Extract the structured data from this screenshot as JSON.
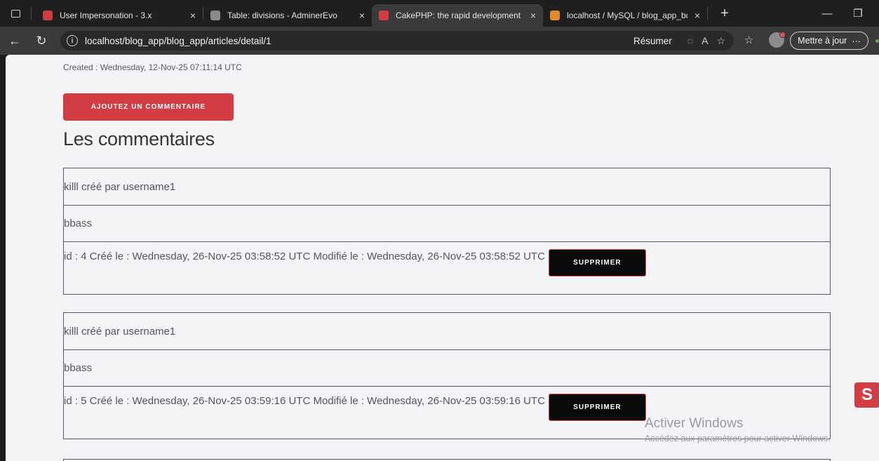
{
  "browser": {
    "tabs": [
      {
        "title": "User Impersonation - 3.x",
        "favicon_color": "#d33c42",
        "active": false
      },
      {
        "title": "Table: divisions - AdminerEvo",
        "favicon_color": "#8a8a8a",
        "active": false
      },
      {
        "title": "CakePHP: the rapid development",
        "favicon_color": "#d33c42",
        "active": true
      },
      {
        "title": "localhost / MySQL / blog_app_bd",
        "favicon_color": "#e08a2a",
        "active": false
      }
    ],
    "close_glyph": "×",
    "new_tab_glyph": "+",
    "url": "localhost/blog_app/blog_app/articles/detail/1",
    "summarize_label": "Résumer",
    "update_label": "Mettre à jour",
    "more_glyph": "⋯"
  },
  "page": {
    "created": "Created : Wednesday, 12-Nov-25 07:11:14 UTC",
    "add_comment_label": "AJOUTEZ UN COMMENTAIRE",
    "heading": "Les commentaires",
    "comments": [
      {
        "title": "killl créé par username1",
        "body": "bbass",
        "meta": "id : 4 Créé le : Wednesday, 26-Nov-25 03:58:52 UTC Modifié le : Wednesday, 26-Nov-25 03:58:52 UTC",
        "delete_label": "SUPPRIMER"
      },
      {
        "title": "killl créé par username1",
        "body": "bbass",
        "meta": "id : 5 Créé le : Wednesday, 26-Nov-25 03:59:16 UTC Modifié le : Wednesday, 26-Nov-25 03:59:16 UTC",
        "delete_label": "SUPPRIMER"
      }
    ]
  },
  "overlay": {
    "watermark_title": "Activer Windows",
    "watermark_sub": "Accédez aux paramètres pour activer Windows.",
    "badge_glyph": "S"
  },
  "colors": {
    "accent": "#d33c42",
    "page_bg": "#f4f4f7",
    "border": "#5b5b5f"
  }
}
